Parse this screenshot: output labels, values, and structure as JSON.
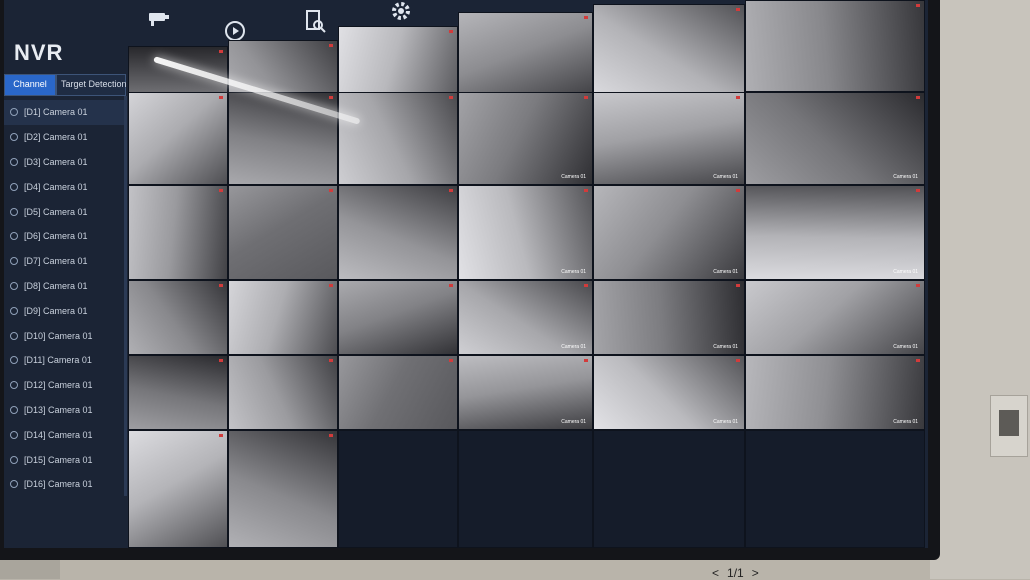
{
  "app": {
    "title": "NVR"
  },
  "tabs": [
    {
      "label": "Channel",
      "active": true
    },
    {
      "label": "Target Detection",
      "active": false
    }
  ],
  "toolbar": {
    "icons": [
      "camera-icon",
      "playback-icon",
      "search-file-icon",
      "gear-icon"
    ]
  },
  "channels": [
    {
      "label": "[D1] Camera 01"
    },
    {
      "label": "[D2] Camera 01"
    },
    {
      "label": "[D3] Camera 01"
    },
    {
      "label": "[D4] Camera 01"
    },
    {
      "label": "[D5] Camera 01"
    },
    {
      "label": "[D6] Camera 01"
    },
    {
      "label": "[D7] Camera 01"
    },
    {
      "label": "[D8] Camera 01"
    },
    {
      "label": "[D9] Camera 01"
    },
    {
      "label": "[D10] Camera 01"
    },
    {
      "label": "[D11] Camera 01"
    },
    {
      "label": "[D12] Camera 01"
    },
    {
      "label": "[D13] Camera 01"
    },
    {
      "label": "[D14] Camera 01"
    },
    {
      "label": "[D15] Camera 01"
    },
    {
      "label": "[D16] Camera 01"
    }
  ],
  "pager": {
    "prev": "<",
    "page": "1/1",
    "next": ">"
  },
  "tile_label": "Camera 01"
}
